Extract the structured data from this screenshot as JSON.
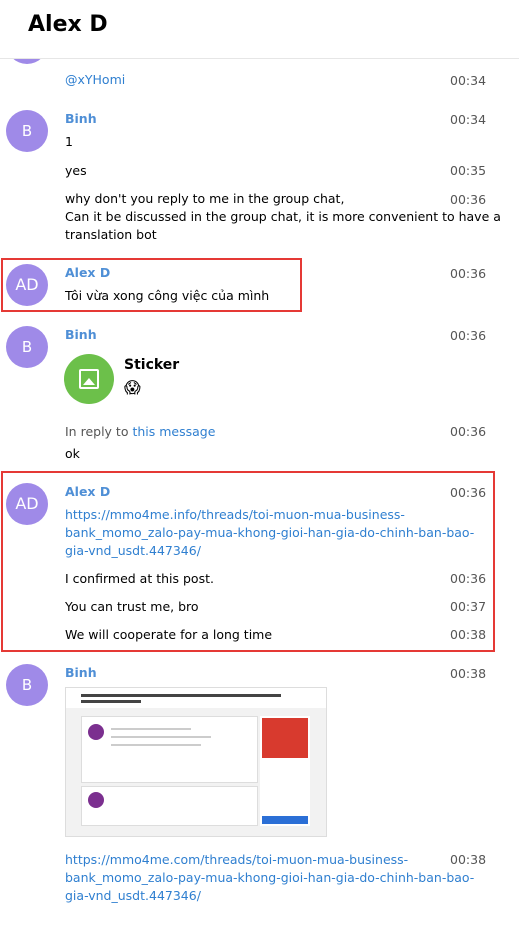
{
  "header": {
    "title": "Alex D"
  },
  "messages": {
    "m0": {
      "text": "@xYHomi",
      "time": "00:34"
    },
    "binh1": {
      "avatar": "B",
      "name": "Binh",
      "time": "00:34",
      "text": "1"
    },
    "m2": {
      "text": "yes",
      "time": "00:35"
    },
    "m3": {
      "line1": "why don't you reply to me in the group chat,",
      "line2": "Can it be discussed in the group chat, it is more convenient to have a",
      "line3": "translation bot",
      "time": "00:36"
    },
    "alex1": {
      "avatar": "AD",
      "name": "Alex D",
      "time": "00:36",
      "text": "Tôi vừa xong công việc của mình"
    },
    "binh2": {
      "avatar": "B",
      "name": "Binh",
      "time": "00:36",
      "sticker_label": "Sticker",
      "sticker_emoji": "😱"
    },
    "reply": {
      "prefix": "In reply to",
      "link": "this message",
      "time": "00:36",
      "text": "ok"
    },
    "alex2": {
      "avatar": "AD",
      "name": "Alex D",
      "time": "00:36",
      "link_line1": "https://mmo4me.info/threads/toi-muon-mua-business-",
      "link_line2": "bank_momo_zalo-pay-mua-khong-gioi-han-gia-do-chinh-ban-bao-",
      "link_line3": "gia-vnd_usdt.447346/"
    },
    "m_confirm": {
      "text": "I confirmed at this post.",
      "time": "00:36"
    },
    "m_trust": {
      "text": "You can trust me, bro",
      "time": "00:37"
    },
    "m_coop": {
      "text": "We will cooperate for a long time",
      "time": "00:38"
    },
    "binh3": {
      "avatar": "B",
      "name": "Binh",
      "time": "00:38"
    },
    "m_link2": {
      "time": "00:38",
      "link_line1": "https://mmo4me.com/threads/toi-muon-mua-business-",
      "link_line2": "bank_momo_zalo-pay-mua-khong-gioi-han-gia-do-chinh-ban-bao-",
      "link_line3": "gia-vnd_usdt.447346/"
    }
  },
  "colors": {
    "accent": "#4f8fd6",
    "avatar": "#9f8ae8",
    "highlight": "#e53935",
    "sticker": "#6cc04a"
  }
}
